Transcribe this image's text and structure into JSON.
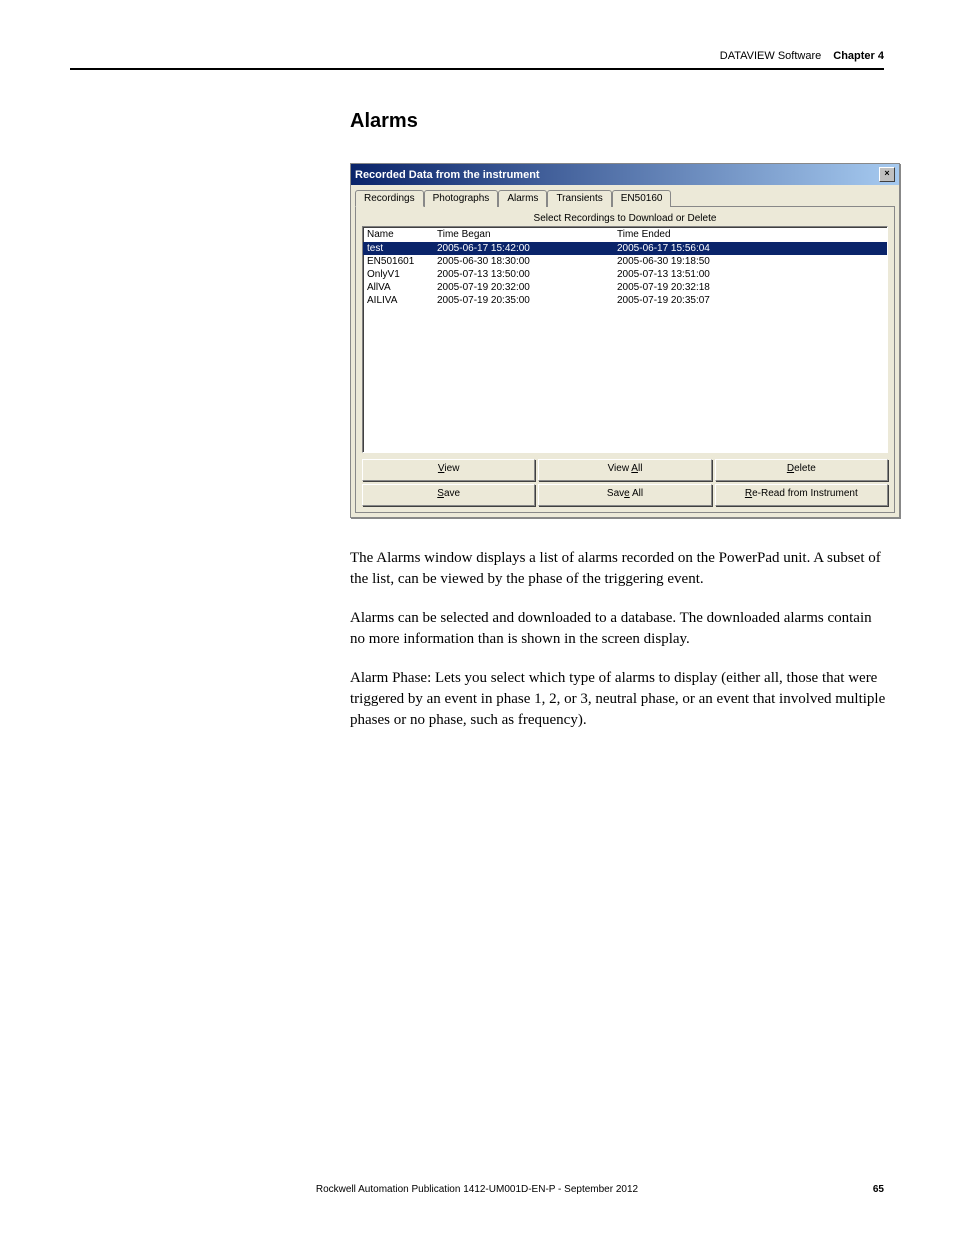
{
  "header": {
    "software": "DATAVIEW Software",
    "chapter": "Chapter 4"
  },
  "section_title": "Alarms",
  "dialog": {
    "title": "Recorded Data from the instrument",
    "close_glyph": "×",
    "tabs": [
      "Recordings",
      "Photographs",
      "Alarms",
      "Transients",
      "EN50160"
    ],
    "group_label": "Select Recordings to Download or Delete",
    "columns": {
      "name": "Name",
      "began": "Time Began",
      "ended": "Time Ended"
    },
    "rows": [
      {
        "name": "test",
        "began": "2005-06-17 15:42:00",
        "ended": "2005-06-17 15:56:04",
        "selected": true
      },
      {
        "name": "EN501601",
        "began": "2005-06-30 18:30:00",
        "ended": "2005-06-30 19:18:50",
        "selected": false
      },
      {
        "name": "OnlyV1",
        "began": "2005-07-13 13:50:00",
        "ended": "2005-07-13 13:51:00",
        "selected": false
      },
      {
        "name": "AllVA",
        "began": "2005-07-19 20:32:00",
        "ended": "2005-07-19 20:32:18",
        "selected": false
      },
      {
        "name": "AILIVA",
        "began": "2005-07-19 20:35:00",
        "ended": "2005-07-19 20:35:07",
        "selected": false
      }
    ],
    "buttons": {
      "view": "View",
      "view_u": "V",
      "view_all": "View All",
      "view_all_u": "A",
      "delete": "Delete",
      "delete_u": "D",
      "save": "Save",
      "save_u": "S",
      "save_all": "Save All",
      "save_all_u": "e",
      "reread": "Re-Read from Instrument",
      "reread_u": "R"
    }
  },
  "paragraphs": [
    "The Alarms window displays a list of alarms recorded on the PowerPad unit. A subset of the list, can be viewed by the phase of the triggering event.",
    "Alarms can be selected and downloaded to a database. The downloaded alarms contain no more information than is shown in the screen display.",
    "Alarm Phase: Lets you select which type of alarms to display (either all, those that were triggered by an event in phase 1, 2, or 3, neutral phase, or an event that involved multiple phases or no phase, such as frequency)."
  ],
  "footer": {
    "publication": "Rockwell Automation Publication 1412-UM001D-EN-P - September 2012",
    "page": "65"
  }
}
